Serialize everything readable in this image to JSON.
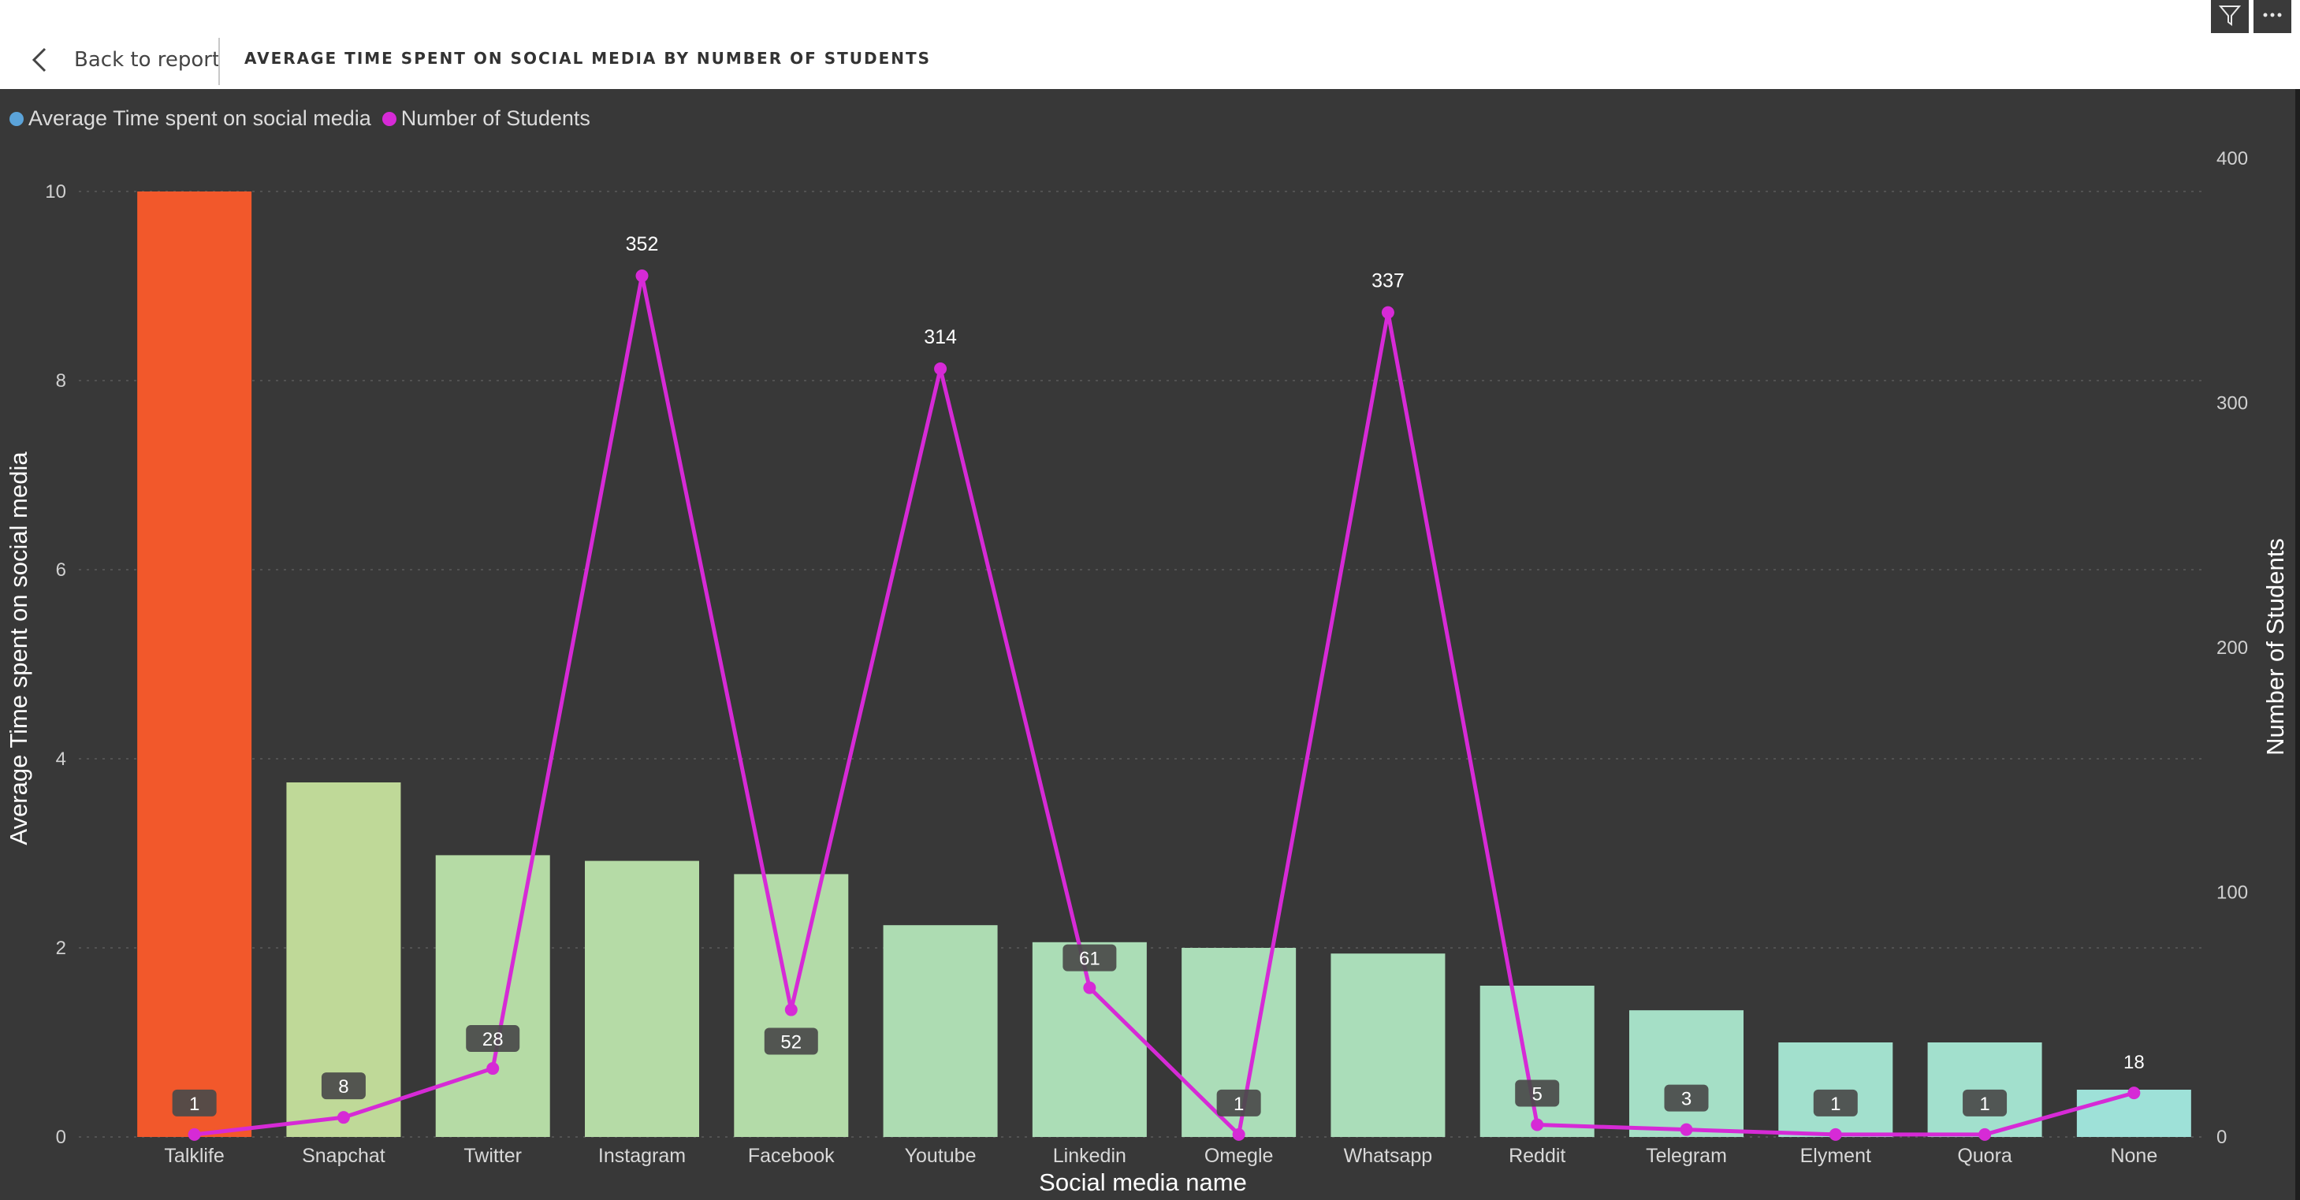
{
  "header": {
    "back_label": "Back to report",
    "title": "AVERAGE TIME SPENT ON SOCIAL MEDIA BY NUMBER OF STUDENTS",
    "filter_icon": "filter-icon",
    "more_icon": "more-options-icon"
  },
  "legend": {
    "bar_series": "Average Time spent on social media",
    "line_series": "Number  of Students"
  },
  "colors": {
    "background": "#383838",
    "line": "#d62ad6",
    "bar_gradient": [
      "#f2582b",
      "#e2c454",
      "#d2d27a",
      "#c6d88e",
      "#aedcaf",
      "#9ee1d8"
    ]
  },
  "chart_data": {
    "type": "bar",
    "xlabel": "Social media name",
    "ylabel": "Average Time spent on social media",
    "y2label": "Number of Students",
    "ylim": [
      0,
      10
    ],
    "y2lim": [
      0,
      400
    ],
    "yticks": [
      0,
      2,
      4,
      6,
      8,
      10
    ],
    "y2ticks": [
      0,
      100,
      200,
      300,
      400
    ],
    "grid": true,
    "legend_position": "top-left",
    "categories": [
      "Talklife",
      "Snapchat",
      "Twitter",
      "Instagram",
      "Facebook",
      "Youtube",
      "Linkedin",
      "Omegle",
      "Whatsapp",
      "Reddit",
      "Telegram",
      "Elyment",
      "Quora",
      "None"
    ],
    "series": [
      {
        "name": "Average Time spent on social media",
        "type": "bar",
        "axis": "left",
        "values": [
          10,
          3.75,
          2.98,
          2.92,
          2.78,
          2.24,
          2.06,
          2.0,
          1.94,
          1.6,
          1.34,
          1.0,
          1.0,
          0.5
        ]
      },
      {
        "name": "Number  of Students",
        "type": "line",
        "axis": "right",
        "values": [
          1,
          8,
          28,
          352,
          52,
          314,
          61,
          1,
          337,
          5,
          3,
          1,
          1,
          18
        ],
        "labels": [
          "1",
          "8",
          "28",
          "352",
          "52",
          "314",
          "61",
          "1",
          "337",
          "5",
          "3",
          "1",
          "1",
          "18"
        ]
      }
    ]
  }
}
